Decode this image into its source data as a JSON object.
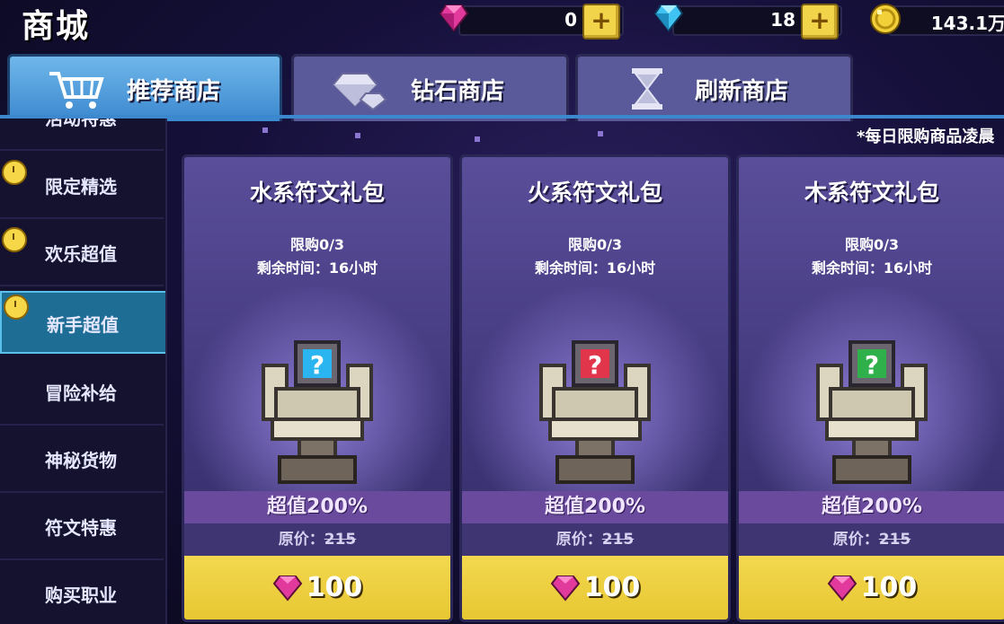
{
  "header": {
    "title": "商城"
  },
  "resources": [
    {
      "icon": "pink-gem-icon",
      "value": "0"
    },
    {
      "icon": "blue-diamond-icon",
      "value": "18"
    },
    {
      "icon": "gold-coin-icon",
      "value": "143.1万"
    }
  ],
  "tabs": [
    {
      "label": "推荐商店",
      "icon": "cart-icon",
      "active": true
    },
    {
      "label": "钻石商店",
      "icon": "diamond-icon",
      "active": false
    },
    {
      "label": "刷新商店",
      "icon": "hourglass-icon",
      "active": false
    }
  ],
  "sidebar": {
    "items": [
      {
        "label": "活动特惠",
        "clock": false
      },
      {
        "label": "限定精选",
        "clock": true
      },
      {
        "label": "欢乐超值",
        "clock": true
      },
      {
        "label": "新手超值",
        "clock": true,
        "active": true
      },
      {
        "label": "冒险补给",
        "clock": false
      },
      {
        "label": "神秘货物",
        "clock": false
      },
      {
        "label": "符文特惠",
        "clock": false
      },
      {
        "label": "购买职业",
        "clock": false
      }
    ]
  },
  "notice": "*每日限购商品凌晨",
  "cards": [
    {
      "name": "水系符文礼包",
      "limit": "限购0/3",
      "remaining": "剩余时间：16小时",
      "bonus": "超值200%",
      "original_label": "原价：",
      "original_price": "215",
      "price": "100",
      "rune_color": "#2ab4f0"
    },
    {
      "name": "火系符文礼包",
      "limit": "限购0/3",
      "remaining": "剩余时间：16小时",
      "bonus": "超值200%",
      "original_label": "原价：",
      "original_price": "215",
      "price": "100",
      "rune_color": "#e0354a"
    },
    {
      "name": "木系符文礼包",
      "limit": "限购0/3",
      "remaining": "剩余时间：16小时",
      "bonus": "超值200%",
      "original_label": "原价：",
      "original_price": "215",
      "price": "100",
      "rune_color": "#2fb04a"
    }
  ],
  "colors": {
    "accent_blue": "#3c88cf",
    "buy_yellow": "#f3d84f",
    "gem_pink": "#e23a9c"
  }
}
